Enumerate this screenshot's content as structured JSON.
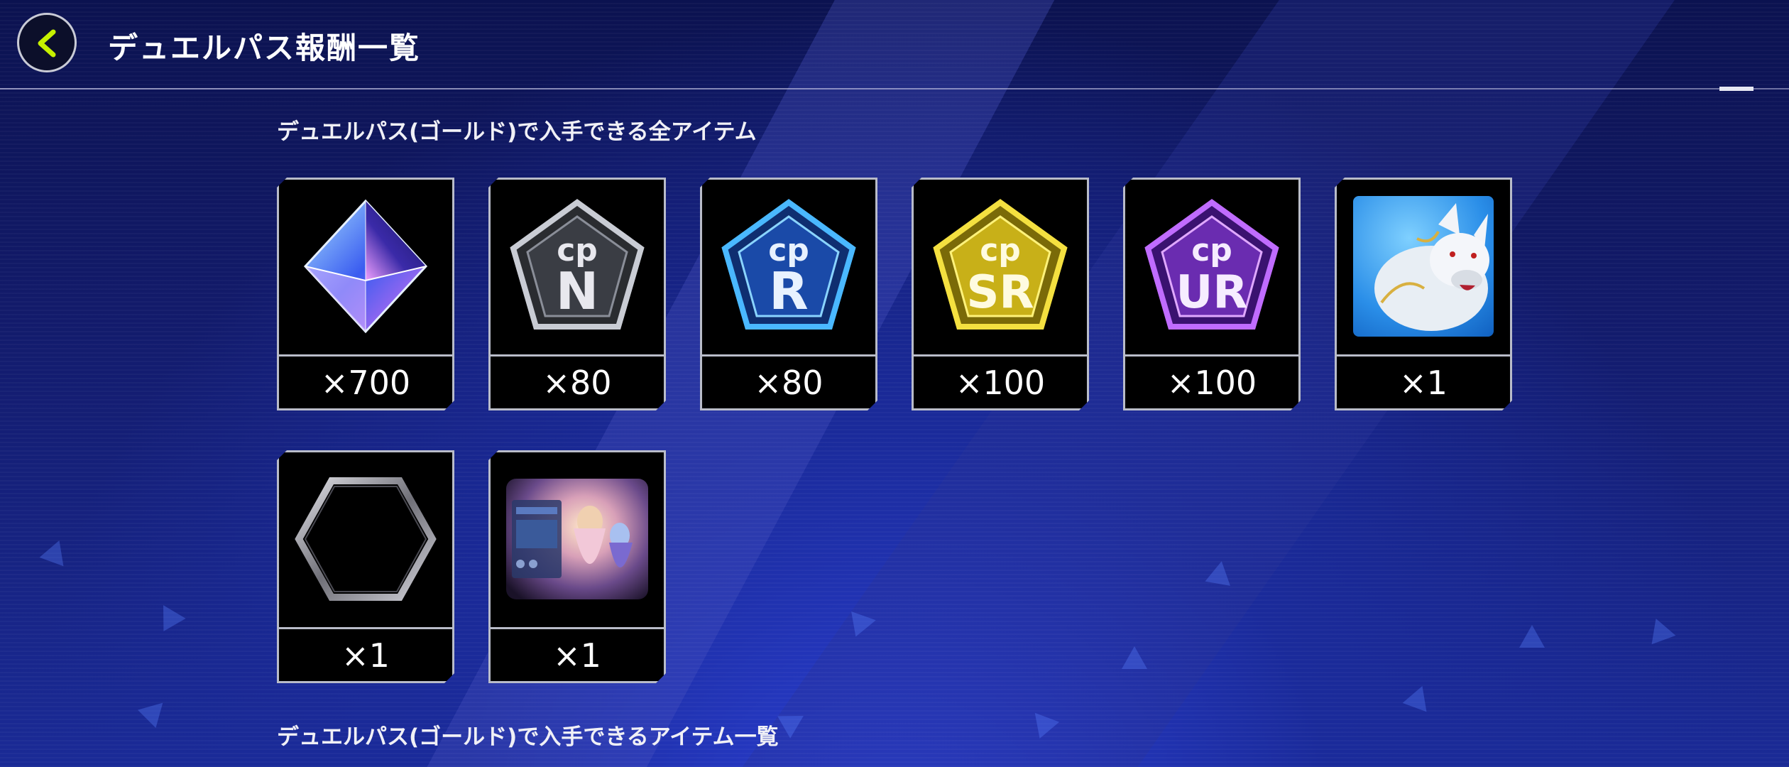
{
  "header": {
    "title": "デュエルパス報酬一覧"
  },
  "sections": {
    "all_items_title": "デュエルパス(ゴールド)で入手できる全アイテム",
    "items_list_title": "デュエルパス(ゴールド)で入手できるアイテム一覧"
  },
  "items": [
    {
      "icon": "gem-icon",
      "qty": "×700"
    },
    {
      "icon": "cp-n-icon",
      "label": "N",
      "qty": "×80",
      "color": "#b8bcc4"
    },
    {
      "icon": "cp-r-icon",
      "label": "R",
      "qty": "×80",
      "color": "#3fa8ff"
    },
    {
      "icon": "cp-sr-icon",
      "label": "SR",
      "qty": "×100",
      "color": "#e8d024"
    },
    {
      "icon": "cp-ur-icon",
      "label": "UR",
      "qty": "×100",
      "color": "#b85cf0"
    },
    {
      "icon": "wolf-mate-icon",
      "qty": "×1"
    },
    {
      "icon": "hexagon-frame-icon",
      "qty": "×1"
    },
    {
      "icon": "field-collage-icon",
      "qty": "×1"
    }
  ],
  "cp_text": "cp",
  "colors": {
    "accent_back": "#c6f000",
    "card_border": "#b9bcc9"
  }
}
